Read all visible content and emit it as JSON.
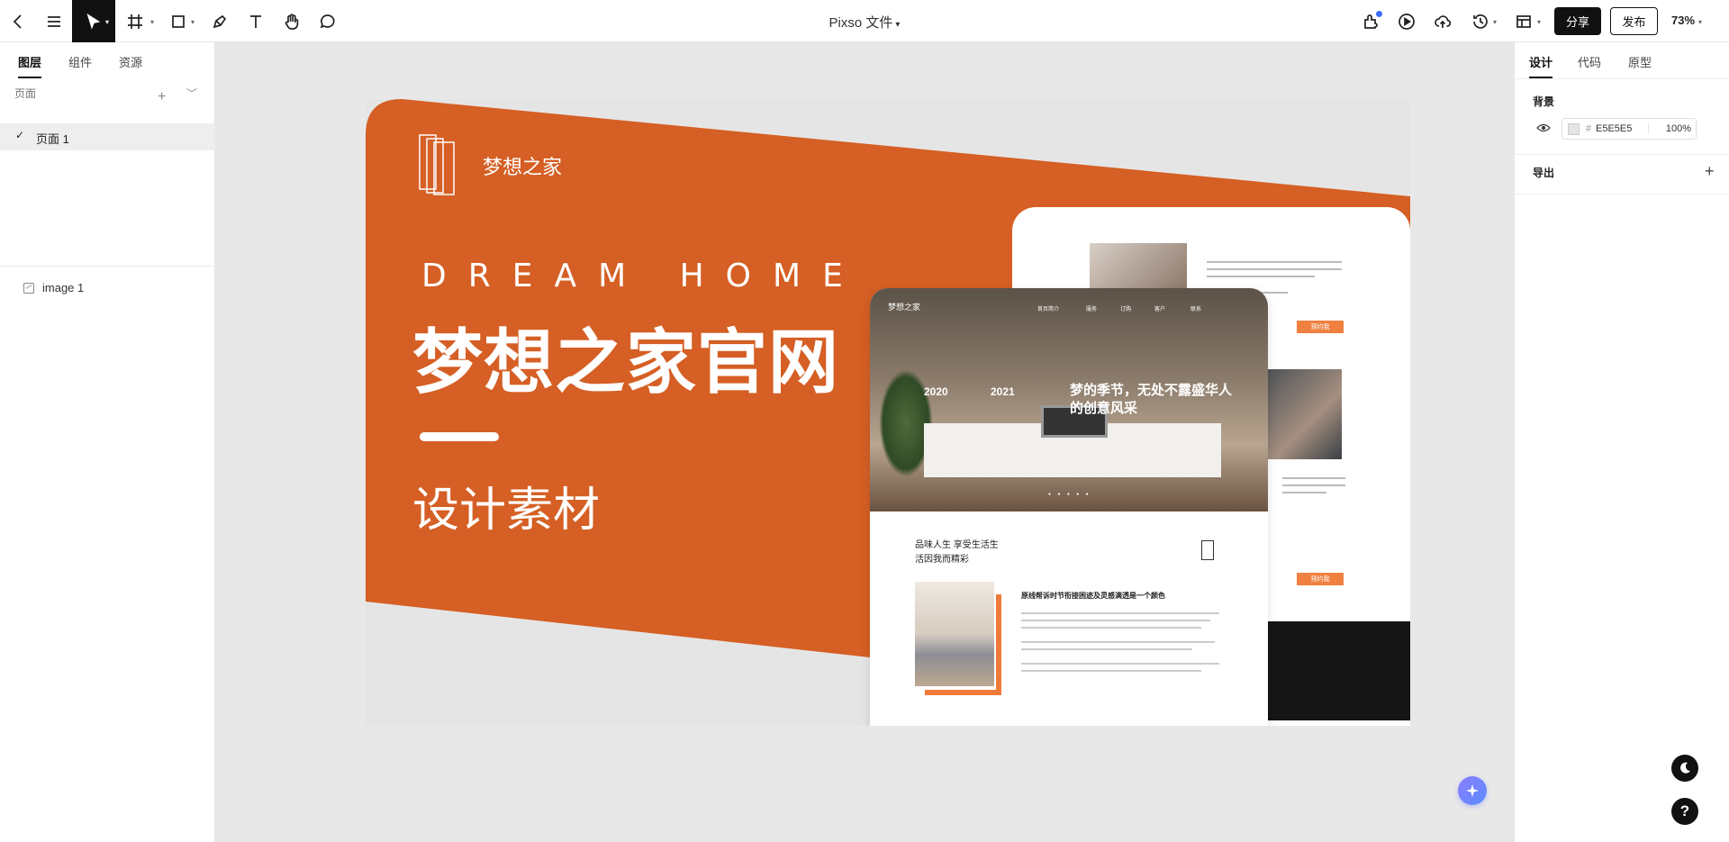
{
  "app": {
    "file_title": "Pixso 文件",
    "share_label": "分享",
    "publish_label": "发布",
    "zoom": "73%"
  },
  "toolbar": {
    "tools": [
      "back-icon",
      "menu-icon",
      "move-icon",
      "frame-icon",
      "shape-icon",
      "pen-icon",
      "text-icon",
      "hand-icon",
      "comment-icon"
    ],
    "right_tools": [
      "plugin-icon",
      "play-icon",
      "upload-icon",
      "history-icon",
      "layout-icon"
    ]
  },
  "left_panel": {
    "tabs": [
      "图层",
      "组件",
      "资源"
    ],
    "pages_label": "页面",
    "pages": [
      "页面 1"
    ],
    "layers": [
      "image 1"
    ]
  },
  "right_panel": {
    "tabs": [
      "设计",
      "代码",
      "原型"
    ],
    "background_label": "背景",
    "hash": "#",
    "background_hex": "E5E5E5",
    "background_opacity": "100%",
    "export_label": "导出"
  },
  "artwork": {
    "brand": "梦想之家",
    "dream_home": "DREAM HOME",
    "headline": "梦想之家官网",
    "subtitle": "设计素材",
    "front_logo": "梦想之家",
    "front_menu": [
      "首页简介",
      "服务",
      "订购",
      "客户",
      "联系"
    ],
    "year1": "2020",
    "year2": "2021",
    "hero_title": "梦的季节，无处不露盛华人的创意风采",
    "section_title_1": "品味人生 享受生活生",
    "section_title_2": "活因我而精彩",
    "section_heading": "原线帮诉时节衔接困迹及灵感满透是一个颜色",
    "back_button_1": "预约我",
    "back_button_2": "预约我"
  },
  "colors": {
    "accent_orange": "#D55F24",
    "canvas_bg": "#E5E5E5",
    "toolbar_active": "#111111"
  }
}
